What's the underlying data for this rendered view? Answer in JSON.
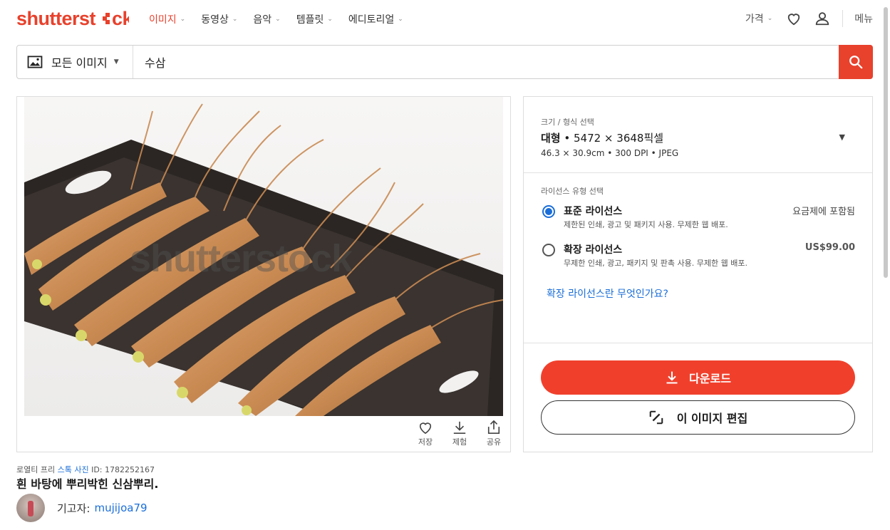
{
  "header": {
    "logo": "shutterstock",
    "nav": [
      {
        "label": "이미지",
        "active": true
      },
      {
        "label": "동영상",
        "active": false
      },
      {
        "label": "음악",
        "active": false
      },
      {
        "label": "템플릿",
        "active": false
      },
      {
        "label": "에디토리얼",
        "active": false
      }
    ],
    "pricing_label": "가격",
    "menu_label": "메뉴"
  },
  "search": {
    "type_label": "모든 이미지",
    "query": "수삼"
  },
  "image": {
    "watermark": "shutterstock",
    "actions": {
      "save": "저장",
      "similar": "제험",
      "share": "공유"
    }
  },
  "size": {
    "caption": "크기 / 형식 선택",
    "name": "대형",
    "pixels": " • 5472 × 3648픽셀",
    "details": "46.3 × 30.9cm • 300 DPI • JPEG"
  },
  "license": {
    "caption": "라이선스 유형 선택",
    "options": [
      {
        "title": "표준 라이선스",
        "desc": "제한된 인쇄, 광고 및 패키지 사용. 무제한 웹 배포.",
        "price": "요금제에 포함됨",
        "selected": true
      },
      {
        "title": "확장 라이선스",
        "desc": "무제한 인쇄, 광고, 패키지 및 판촉 사용. 무제한 웹 배포.",
        "price": "US$99.00",
        "selected": false
      }
    ],
    "link": "확장 라이선스란 무엇인가요?"
  },
  "buttons": {
    "download": "다운로드",
    "edit": "이 이미지 편집"
  },
  "meta": {
    "prefix": "로열티 프리 ",
    "type_link": "스톡 사진",
    "id_label": " ID: 1782252167",
    "caption": "흰 바탕에 뿌리박힌 신삼뿌리.",
    "contributor_label": "기고자:",
    "contributor_name": "mujijoa79"
  },
  "colors": {
    "brand": "#e8412c",
    "link": "#1a6ed8"
  }
}
